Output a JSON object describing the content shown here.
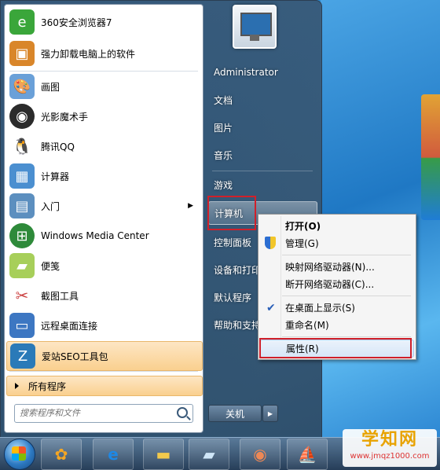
{
  "start_menu": {
    "pinned": [
      {
        "label": "360安全浏览器7",
        "icon": "browser-360-icon",
        "color": "#3aa63a"
      },
      {
        "label": "强力卸载电脑上的软件",
        "icon": "uninstall-box-icon",
        "color": "#d9862a"
      }
    ],
    "recent": [
      {
        "label": "画图",
        "icon": "paint-palette-icon",
        "color": "#6aa0d8"
      },
      {
        "label": "光影魔术手",
        "icon": "aperture-icon",
        "color": "#2b2b2b"
      },
      {
        "label": "腾讯QQ",
        "icon": "qq-penguin-icon",
        "color": "#1a1a1a"
      },
      {
        "label": "计算器",
        "icon": "calculator-icon",
        "color": "#4b8fd0"
      },
      {
        "label": "入门",
        "icon": "getting-started-icon",
        "color": "#5c8fbf"
      },
      {
        "label": "Windows Media Center",
        "icon": "media-center-icon",
        "color": "#2e8a3a"
      },
      {
        "label": "便笺",
        "icon": "sticky-notes-icon",
        "color": "#a7cf5a"
      },
      {
        "label": "截图工具",
        "icon": "snipping-tool-icon",
        "color": "#c44"
      },
      {
        "label": "远程桌面连接",
        "icon": "remote-desktop-icon",
        "color": "#3d77c2"
      },
      {
        "label": "爱站SEO工具包",
        "icon": "seo-toolkit-icon",
        "color": "#2a7ab8"
      }
    ],
    "all_programs": "所有程序",
    "search_placeholder": "搜索程序和文件",
    "right": {
      "user": "Administrator",
      "items": [
        "文档",
        "图片",
        "音乐",
        "游戏",
        "计算机",
        "控制面板",
        "设备和打印",
        "默认程序",
        "帮助和支持"
      ],
      "shutdown": "关机"
    }
  },
  "context_menu": {
    "items": [
      {
        "label": "打开(O)",
        "bold": true
      },
      {
        "label": "管理(G)"
      },
      {
        "label": "映射网络驱动器(N)..."
      },
      {
        "label": "断开网络驱动器(C)..."
      },
      {
        "label": "在桌面上显示(S)",
        "checked": true
      },
      {
        "label": "重命名(M)"
      },
      {
        "label": "属性(R)"
      }
    ]
  },
  "watermark": {
    "title": "学知网",
    "url": "www.jmqz1000.com"
  },
  "colors": {
    "highlight_red": "#d0202a",
    "menu_orange": "#fad08f"
  }
}
